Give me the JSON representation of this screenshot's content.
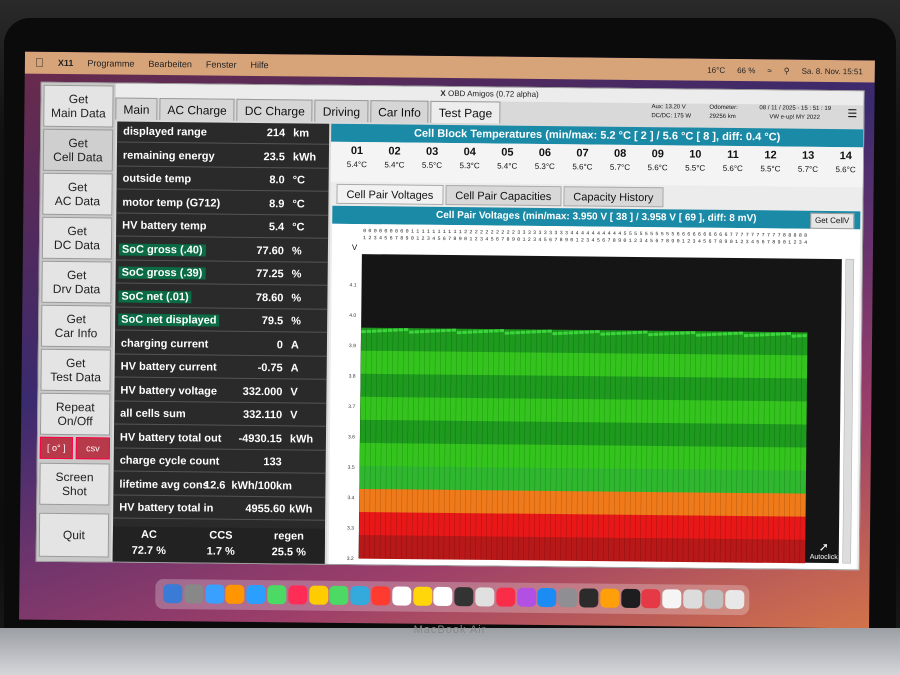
{
  "menubar": {
    "app": "X11",
    "items": [
      "Programme",
      "Bearbeiten",
      "Fenster",
      "Hilfe"
    ],
    "status": [
      "16°C",
      "66 %",
      "Sa. 8. Nov.  15:51"
    ]
  },
  "window": {
    "title": "OBD Amigos (0.72 alpha)",
    "info": {
      "aux_label": "Aux:",
      "aux_value": "13.20  V",
      "dcdc_label": "DC/DC:",
      "dcdc_value": "175  W",
      "odometer_label": "Odometer:",
      "odometer_value": "29256 km",
      "datetime": "08 / 11 / 2025  -  15 : 51 : 19",
      "vehicle": "VW e-up! MY 2022"
    }
  },
  "sidebar": {
    "buttons": [
      "Get\nMain Data",
      "Get\nCell Data",
      "Get\nAC Data",
      "Get\nDC Data",
      "Get\nDrv Data",
      "Get\nCar Info",
      "Get\nTest Data",
      "Repeat\nOn/Off"
    ],
    "degree_btn": "[ o° ]",
    "csv_btn": "csv",
    "screenshot": "Screen\nShot",
    "quit": "Quit"
  },
  "tabs": [
    "Main",
    "AC Charge",
    "DC Charge",
    "Driving",
    "Car Info",
    "Test Page"
  ],
  "data_rows": [
    {
      "label": "displayed range",
      "value": "214",
      "unit": "km"
    },
    {
      "label": "remaining energy",
      "value": "23.5",
      "unit": "kWh"
    },
    {
      "label": "outside temp",
      "value": "8.0",
      "unit": "°C"
    },
    {
      "label": "motor temp (G712)",
      "value": "8.9",
      "unit": "°C"
    },
    {
      "label": "HV battery temp",
      "value": "5.4",
      "unit": "°C"
    },
    {
      "label": "SoC gross (.40)",
      "value": "77.60",
      "unit": "%"
    },
    {
      "label": "SoC gross (.39)",
      "value": "77.25",
      "unit": "%"
    },
    {
      "label": "SoC net (.01)",
      "value": "78.60",
      "unit": "%"
    },
    {
      "label": "SoC net displayed",
      "value": "79.5",
      "unit": "%"
    },
    {
      "label": "charging current",
      "value": "0",
      "unit": "A"
    },
    {
      "label": "HV battery current",
      "value": "-0.75",
      "unit": "A"
    },
    {
      "label": "HV battery voltage",
      "value": "332.000",
      "unit": "V"
    },
    {
      "label": "all cells sum",
      "value": "332.110",
      "unit": "V"
    },
    {
      "label": "HV battery total out",
      "value": "-4930.15",
      "unit": "kWh"
    },
    {
      "label": "charge cycle count",
      "value": "133",
      "unit": ""
    },
    {
      "label": "lifetime avg cons",
      "value": "12.6",
      "unit": "kWh/100km"
    },
    {
      "label": "HV battery total in",
      "value": "4955.60",
      "unit": "kWh"
    }
  ],
  "summary": {
    "ac_label": "AC",
    "ac_value": "72.7  %",
    "ccs_label": "CCS",
    "ccs_value": "1.7  %",
    "regen_label": "regen",
    "regen_value": "25.5  %"
  },
  "cell_block": {
    "title": "Cell Block Temperatures (min/max:  5.2 °C [ 2 ]  /  5.6 °C [ 8 ],  diff:  0.4 °C)",
    "blocks": [
      {
        "n": "01",
        "t": "5.4°C"
      },
      {
        "n": "02",
        "t": "5.4°C"
      },
      {
        "n": "03",
        "t": "5.5°C"
      },
      {
        "n": "04",
        "t": "5.3°C"
      },
      {
        "n": "05",
        "t": "5.4°C"
      },
      {
        "n": "06",
        "t": "5.3°C"
      },
      {
        "n": "07",
        "t": "5.6°C"
      },
      {
        "n": "08",
        "t": "5.7°C"
      },
      {
        "n": "09",
        "t": "5.6°C"
      },
      {
        "n": "10",
        "t": "5.5°C"
      },
      {
        "n": "11",
        "t": "5.6°C"
      },
      {
        "n": "12",
        "t": "5.5°C"
      },
      {
        "n": "13",
        "t": "5.7°C"
      },
      {
        "n": "14",
        "t": "5.6°C"
      }
    ]
  },
  "subtabs": [
    "Cell Pair Voltages",
    "Cell Pair Capacities",
    "Capacity History"
  ],
  "volt_title": "Cell Pair Voltages (min/max:  3.950 V [ 38 ]  /  3.958 V [ 69 ],  diff:  8 mV)",
  "get_cellv": "Get CellV",
  "chart_data": {
    "type": "bar",
    "ylabel": "V",
    "ylim": [
      3.2,
      4.2
    ],
    "yticks": [
      "4.1",
      "4.0",
      "3.9",
      "3.8",
      "3.7",
      "3.6",
      "3.5",
      "3.4",
      "3.3",
      "3.2"
    ],
    "cell_count": 84,
    "values_min": 3.95,
    "values_max": 3.958,
    "min_index": 38,
    "max_index": 69,
    "band_colors": [
      "#1e9a1e",
      "#34c41e",
      "#1e9a1e",
      "#34c41e",
      "#1e9a1e",
      "#34c41e",
      "#2fb82f",
      "#f07a1a",
      "#e81818",
      "#b81818"
    ]
  },
  "autoclick": "Autoclick",
  "laptop_brand": "MacBook Air"
}
